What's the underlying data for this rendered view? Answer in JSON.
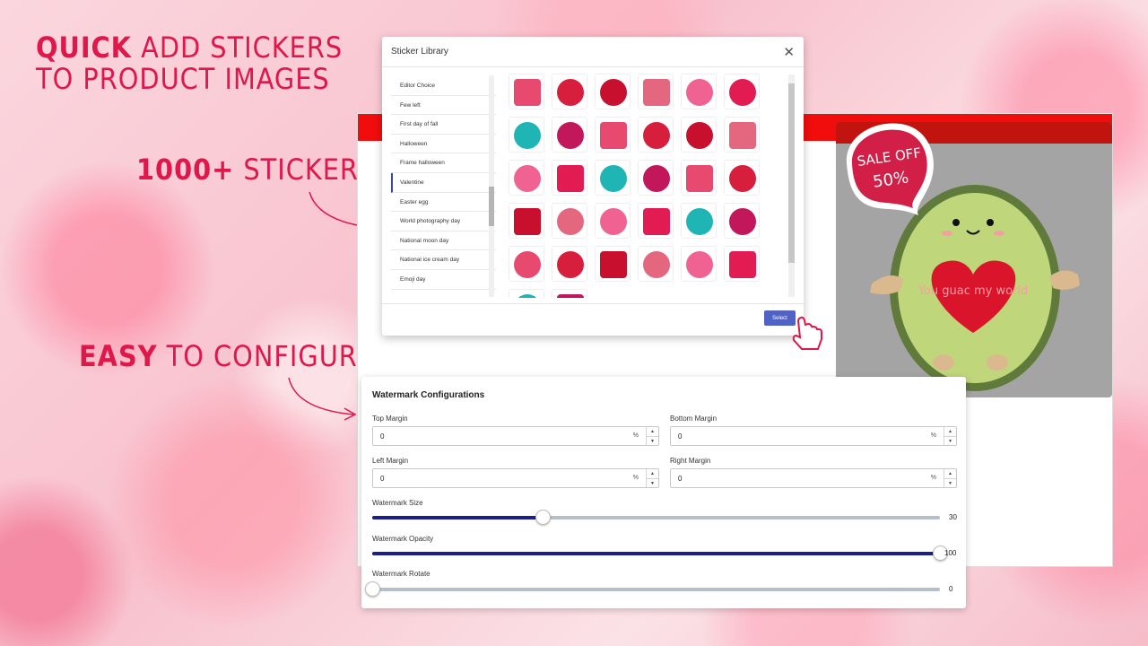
{
  "headlines": {
    "line1_bold": "QUICK",
    "line1_rest": "ADD STICKERS",
    "line2": "TO PRODUCT IMAGES",
    "stickers_bold": "1000+",
    "stickers_rest": "STICKERS",
    "easy_bold": "EASY",
    "easy_rest": "TO CONFIGURE"
  },
  "sticker_library": {
    "title": "Sticker Library",
    "close_icon": "close-icon",
    "categories": [
      {
        "label": "Editor Choice"
      },
      {
        "label": "Few left"
      },
      {
        "label": "First day of fall"
      },
      {
        "label": "Halloween"
      },
      {
        "label": "Frame halloween"
      },
      {
        "label": "Valentine",
        "active": true
      },
      {
        "label": "Easter egg"
      },
      {
        "label": "World photography day"
      },
      {
        "label": "National moon day"
      },
      {
        "label": "National ice cream day"
      },
      {
        "label": "Emoji day"
      }
    ],
    "select_label": "Select"
  },
  "product_preview": {
    "sticker_text_1": "SALE OFF",
    "sticker_text_2": "50%",
    "heart_text": "You guac my world"
  },
  "watermark": {
    "title": "Watermark Configurations",
    "top_margin": {
      "label": "Top Margin",
      "value": "0",
      "unit": "%"
    },
    "bottom_margin": {
      "label": "Bottom Margin",
      "value": "0",
      "unit": "%"
    },
    "left_margin": {
      "label": "Left Margin",
      "value": "0",
      "unit": "%"
    },
    "right_margin": {
      "label": "Right Margin",
      "value": "0",
      "unit": "%"
    },
    "size": {
      "label": "Watermark Size",
      "value": "30",
      "fraction": 0.3
    },
    "opacity": {
      "label": "Watermark Opacity",
      "value": "100",
      "fraction": 1.0
    },
    "rotate": {
      "label": "Watermark Rotate",
      "value": "0",
      "fraction": 0.0
    }
  },
  "colors": {
    "accent": "#e0174a",
    "primary_button": "#5062c4",
    "slider_fill": "#1b1f8c",
    "header_bar": "#f20d0d"
  }
}
